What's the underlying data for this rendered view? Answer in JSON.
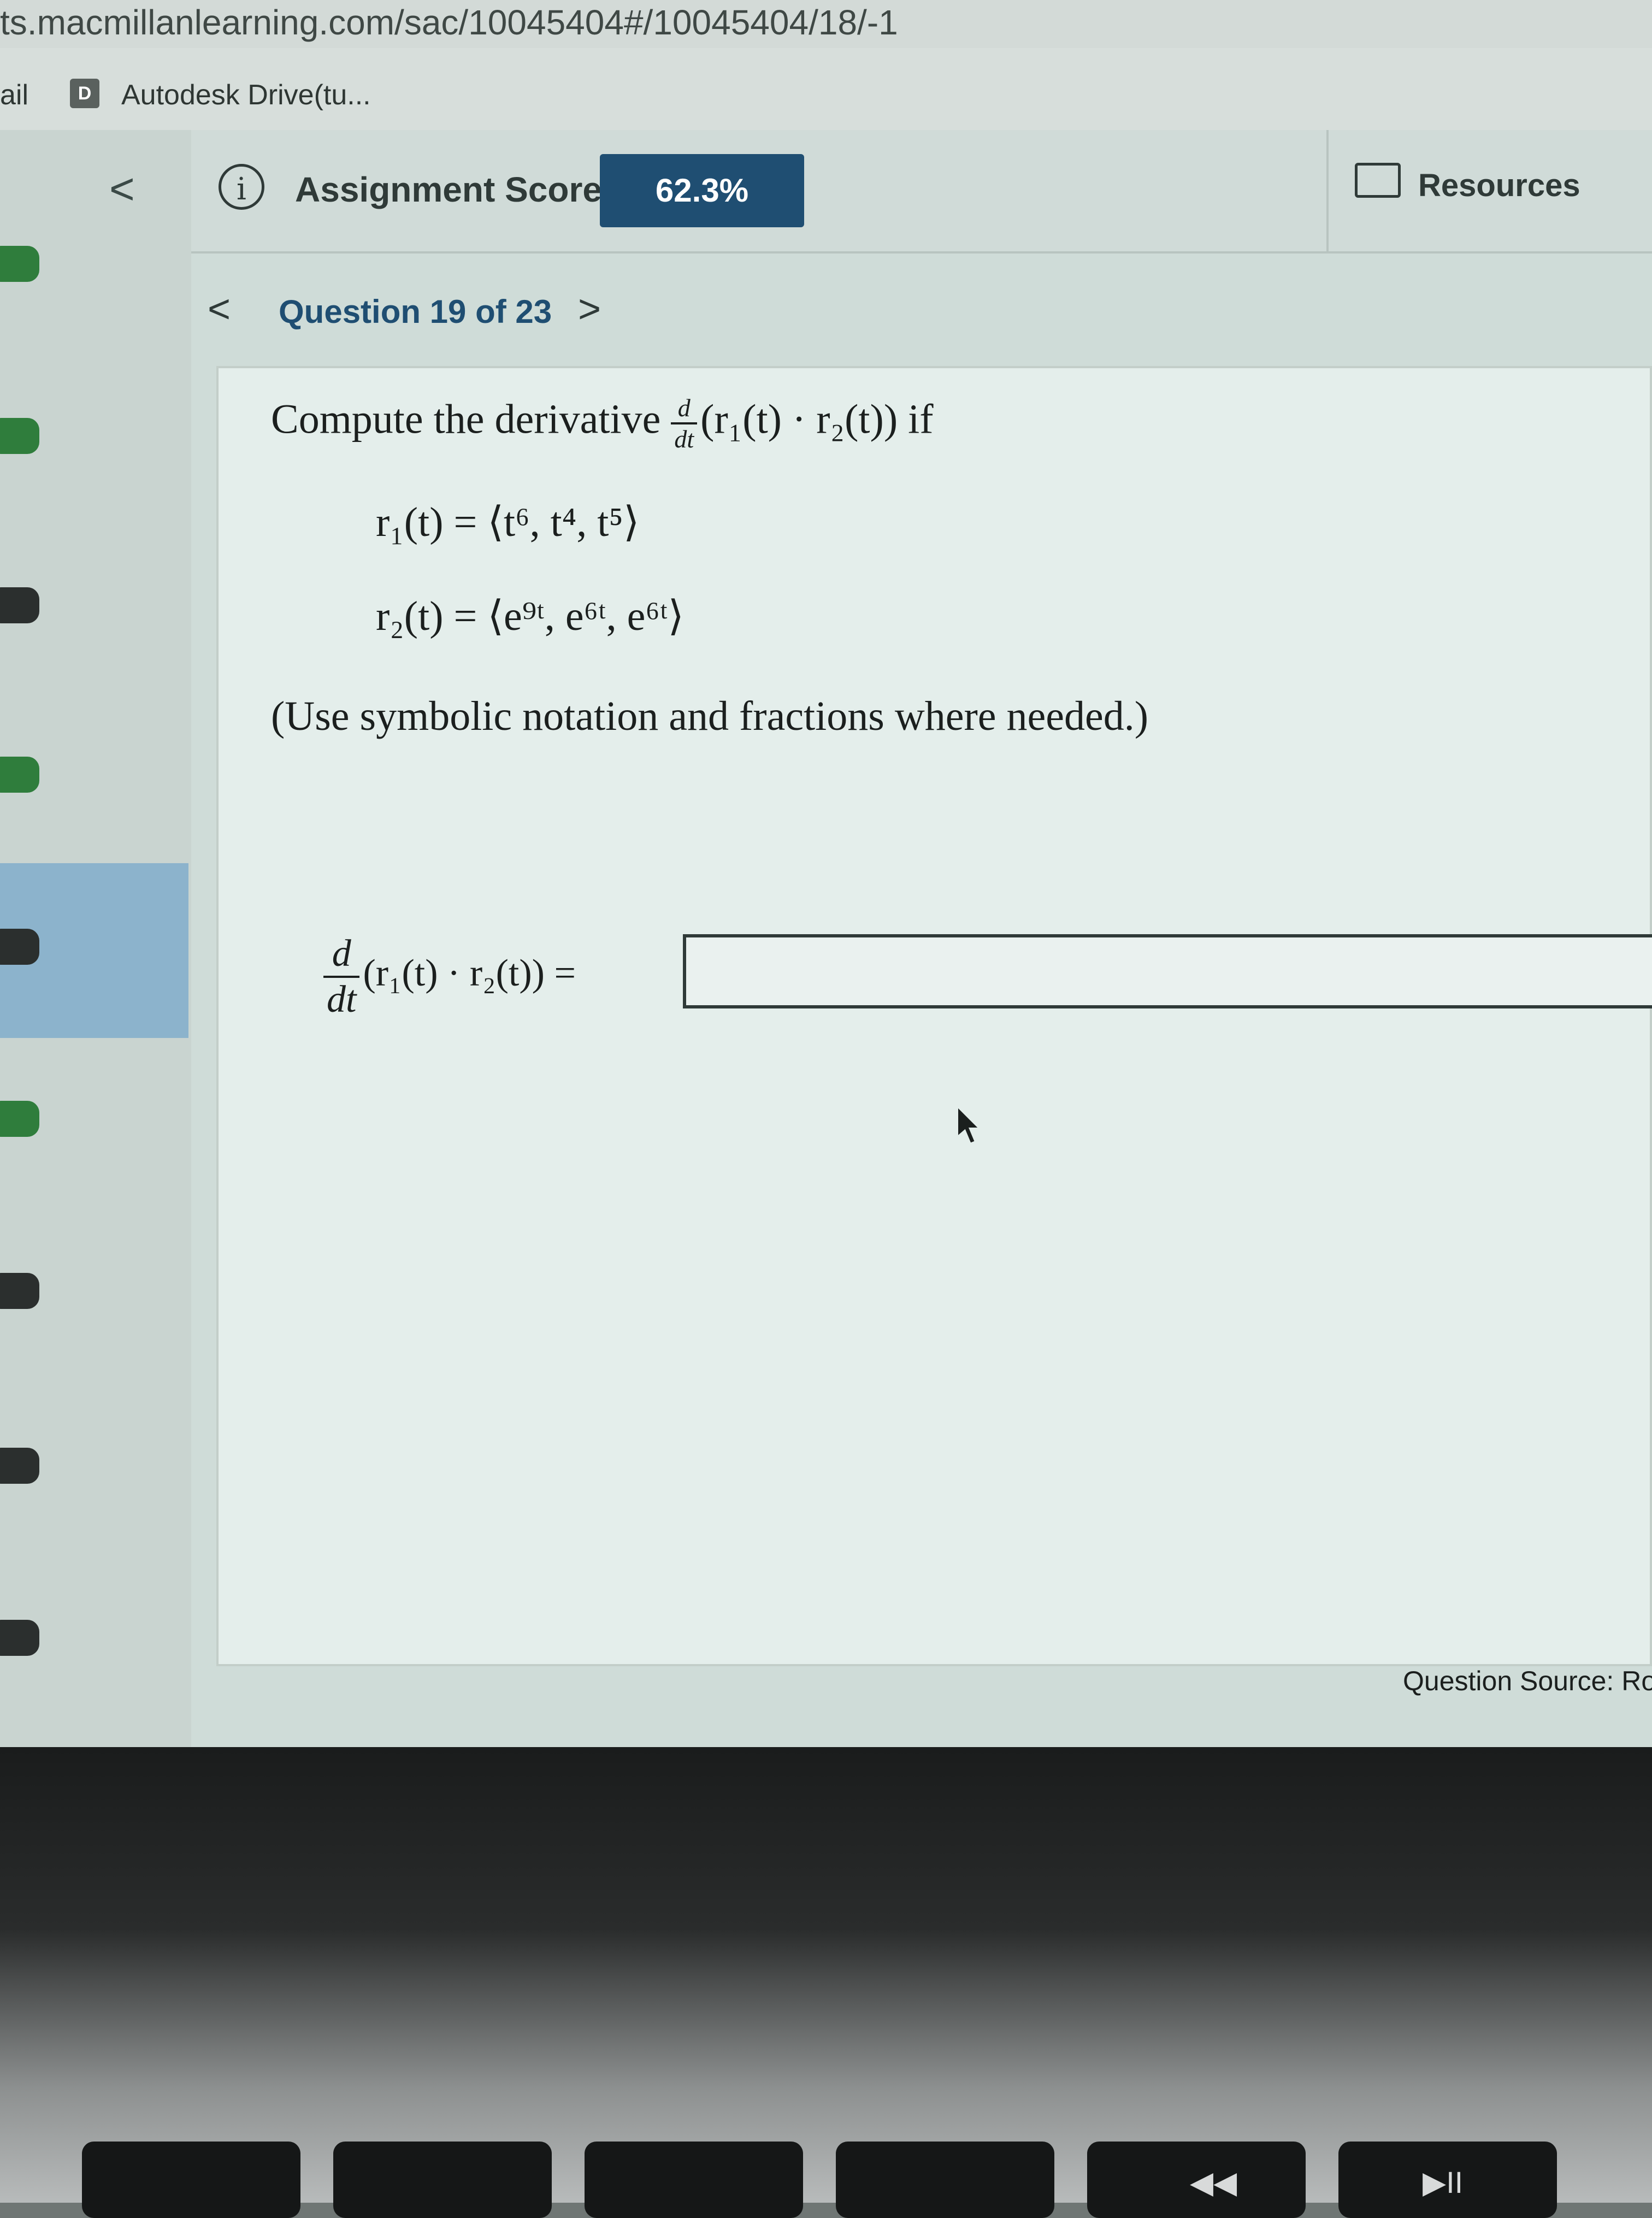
{
  "browser": {
    "url": "ts.macmillanlearning.com/sac/10045404#/10045404/18/-1",
    "bookmarks": [
      {
        "label": "ail"
      },
      {
        "favicon": "D",
        "label": "Autodesk Drive(tu..."
      }
    ]
  },
  "header": {
    "back_icon": "<",
    "info_icon": "i",
    "score_label": "Assignment Score:",
    "score_value": "62.3%",
    "resources_label": "Resources"
  },
  "navigation": {
    "prev": "<",
    "question_label": "Question 19 of 23",
    "next": ">"
  },
  "question": {
    "prompt_text": "Compute the derivative",
    "prompt_suffix": "(r₁(t) · r₂(t)) if",
    "frac_num": "d",
    "frac_den": "dt",
    "r1": "r₁(t) = ⟨t⁶, t⁴, t⁵⟩",
    "r2": "r₂(t) = ⟨e⁹ᵗ, e⁶ᵗ, e⁶ᵗ⟩",
    "hint": "(Use symbolic notation and fractions where needed.)",
    "answer_lhs": "(r₁(t) · r₂(t)) =",
    "answer_value": ""
  },
  "footer": {
    "source": "Question Source: Rog"
  },
  "left_rail_pill_colors": [
    "#2f7d3c",
    "#2f7d3c",
    "#2b2f2e",
    "#2f7d3c",
    "#2b2f2e",
    "#2f7d3c",
    "#2b2f2e",
    "#2b2f2e",
    "#2b2f2e"
  ],
  "colors": {
    "accent": "#1f4e72",
    "correct": "#2f7d3c"
  },
  "keyboard": {
    "play_pause_label": "▶II",
    "rewind_label": "◀◀"
  }
}
